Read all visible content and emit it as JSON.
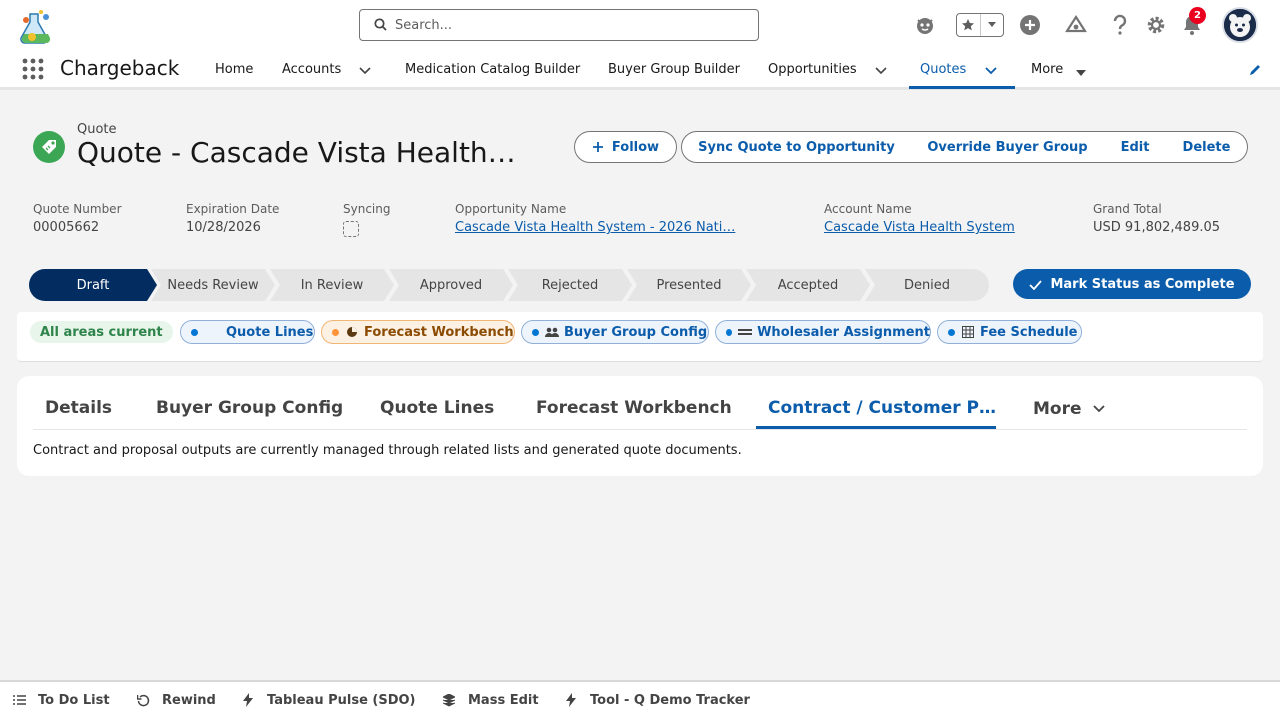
{
  "header": {
    "search_placeholder": "Search...",
    "notification_count": "2",
    "icons": [
      "logo-icon",
      "search-icon",
      "agent-icon",
      "favorites-star-icon",
      "favorites-dropdown-icon",
      "add-icon",
      "trailhead-icon",
      "help-icon",
      "setup-gear-icon",
      "notifications-bell-icon",
      "avatar"
    ]
  },
  "nav": {
    "app_name": "Chargeback",
    "items": [
      {
        "label": "Home"
      },
      {
        "label": "Accounts"
      },
      {
        "label": "Medication Catalog Builder"
      },
      {
        "label": "Buyer Group Builder"
      },
      {
        "label": "Opportunities"
      },
      {
        "label": "Quotes"
      },
      {
        "label": "More"
      }
    ],
    "active": "Quotes"
  },
  "record": {
    "object_type": "Quote",
    "title": "Quote - Cascade Vista Health…",
    "buttons": {
      "follow": "Follow",
      "sync": "Sync Quote to Opportunity",
      "override": "Override Buyer Group",
      "edit": "Edit",
      "delete": "Delete"
    },
    "fields": [
      {
        "label": "Quote Number",
        "value": "00005662"
      },
      {
        "label": "Expiration Date",
        "value": "10/28/2026"
      },
      {
        "label": "Syncing",
        "value": ""
      },
      {
        "label": "Opportunity Name",
        "value": "Cascade Vista Health System - 2026 Nati…"
      },
      {
        "label": "Account Name",
        "value": "Cascade Vista Health System"
      },
      {
        "label": "Grand Total",
        "value": "USD 91,802,489.05"
      }
    ]
  },
  "path": {
    "stages": [
      {
        "label": "Draft",
        "current": true
      },
      {
        "label": "Needs Review"
      },
      {
        "label": "In Review"
      },
      {
        "label": "Approved"
      },
      {
        "label": "Rejected"
      },
      {
        "label": "Presented"
      },
      {
        "label": "Accepted"
      },
      {
        "label": "Denied"
      }
    ],
    "mark_button": "Mark Status as Complete"
  },
  "chips": {
    "current": "All areas current",
    "items": [
      {
        "label": "Quote Lines",
        "status": "info"
      },
      {
        "label": "Forecast Workbench",
        "status": "warning"
      },
      {
        "label": "Buyer Group Config",
        "status": "info"
      },
      {
        "label": "Wholesaler Assignment",
        "status": "info"
      },
      {
        "label": "Fee Schedule",
        "status": "info"
      }
    ]
  },
  "tabs": {
    "items": [
      {
        "label": "Details"
      },
      {
        "label": "Buyer Group Config"
      },
      {
        "label": "Quote Lines"
      },
      {
        "label": "Forecast Workbench"
      },
      {
        "label": "Contract / Customer P…"
      },
      {
        "label": "More"
      }
    ],
    "active": "Contract / Customer P…",
    "content": "Contract and proposal outputs are currently managed through related lists and generated quote documents."
  },
  "utility_bar": {
    "items": [
      {
        "label": "To Do List",
        "icon": "list-icon"
      },
      {
        "label": "Rewind",
        "icon": "rewind-icon"
      },
      {
        "label": "Tableau Pulse (SDO)",
        "icon": "bolt-icon"
      },
      {
        "label": "Mass Edit",
        "icon": "layers-icon"
      },
      {
        "label": "Tool - Q Demo Tracker",
        "icon": "bolt-icon"
      }
    ]
  },
  "colors": {
    "brand_blue": "#0b5cab",
    "path_current": "#032d60",
    "path_inactive": "#e5e5e5",
    "record_icon_green": "#3ba755",
    "badge_red": "#ea001e"
  }
}
